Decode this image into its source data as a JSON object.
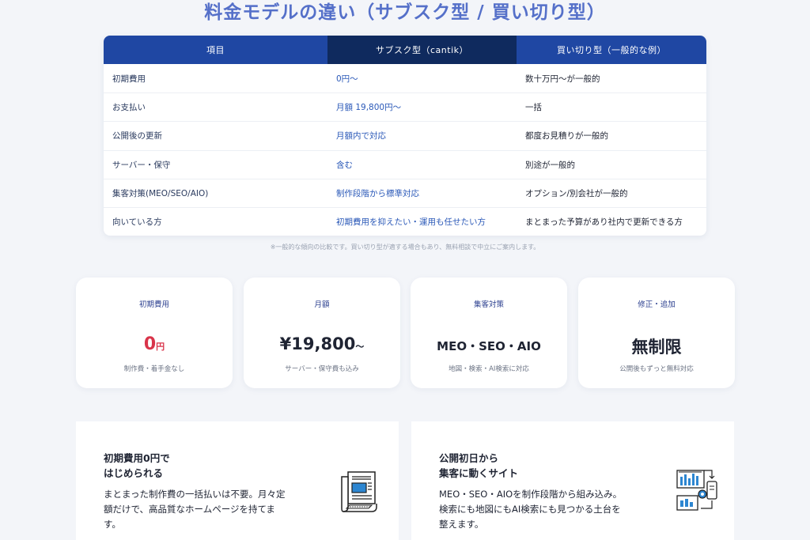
{
  "page_title": "料金モデルの違い（サブスク型 / 買い切り型）",
  "table": {
    "headers": [
      "項目",
      "サブスク型（cantik）",
      "買い切り型（一般的な例）"
    ],
    "rows": [
      [
        "初期費用",
        "0円〜",
        "数十万円〜が一般的"
      ],
      [
        "お支払い",
        "月額 19,800円〜",
        "一括"
      ],
      [
        "公開後の更新",
        "月額内で対応",
        "都度お見積りが一般的"
      ],
      [
        "サーバー・保守",
        "含む",
        "別途が一般的"
      ],
      [
        "集客対策(MEO/SEO/AIO)",
        "制作段階から標準対応",
        "オプション/別会社が一般的"
      ],
      [
        "向いている方",
        "初期費用を抑えたい・運用も任せたい方",
        "まとまった予算があり社内で更新できる方"
      ]
    ],
    "note": "※一般的な傾向の比較です。買い切り型が適する場合もあり、無料相談で中立にご案内します。"
  },
  "stats": [
    {
      "label": "初期費用",
      "value": "0",
      "unit": "円",
      "sub": "制作費・着手金なし"
    },
    {
      "label": "月額",
      "value": "¥19,800",
      "unit": "〜",
      "sub": "サーバー・保守費も込み"
    },
    {
      "label": "集客対策",
      "value": "MEO・SEO・AIO",
      "sub": "地図・検索・AI検索に対応"
    },
    {
      "label": "修正・追加",
      "value": "無制限",
      "sub": "公開後もずっと無料対応"
    }
  ],
  "features": [
    {
      "heading_1": "初期費用0円で",
      "heading_2": "はじめられる",
      "body_1": "まとまった制作費の一括払いは不要。月々定",
      "body_2": "額だけで、高品質なホームページを持てま",
      "body_3": "す。",
      "icon": "newspaper-icon"
    },
    {
      "heading_1": "公開初日から",
      "heading_2": "集客に動くサイト",
      "body_1": "MEO・SEO・AIOを制作段階から組み込み。",
      "body_2": "検索にも地図にもAI検索にも見つかる土台を",
      "body_3": "整えます。",
      "icon": "dashboard-gear-icon"
    }
  ],
  "colors": {
    "title": "#5570c9",
    "header_blue": "#1f47a3",
    "header_navy": "#0f2a5e",
    "accent_red": "#d9344a",
    "link_blue": "#2b59b8"
  }
}
